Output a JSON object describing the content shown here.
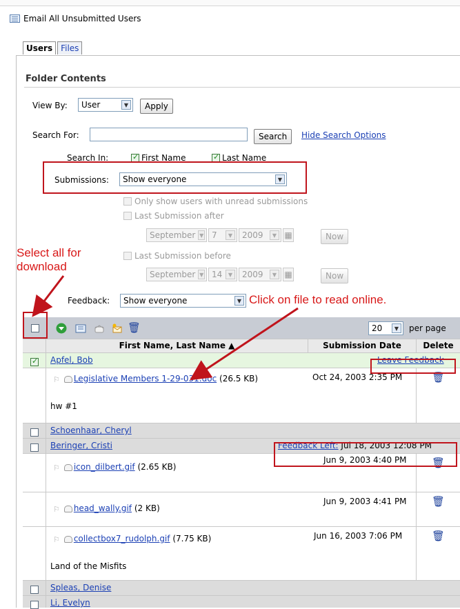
{
  "header": {
    "email_all": "Email All Unsubmitted Users"
  },
  "tabs": [
    {
      "label": "Users"
    },
    {
      "label": "Files"
    }
  ],
  "folder": {
    "title": "Folder Contents"
  },
  "view_by": {
    "label": "View By:",
    "value": "User",
    "apply": "Apply"
  },
  "search": {
    "label": "Search For:",
    "value": "",
    "button": "Search",
    "hide_options": "Hide Search Options"
  },
  "search_in": {
    "label": "Search In:",
    "first_name": "First Name",
    "last_name": "Last Name"
  },
  "submissions": {
    "label": "Submissions:",
    "value": "Show everyone"
  },
  "filters": {
    "unread": "Only show users with unread submissions",
    "after": "Last Submission after",
    "before": "Last Submission before",
    "after_date": {
      "month": "September",
      "day": "7",
      "year": "2009"
    },
    "before_date": {
      "month": "September",
      "day": "14",
      "year": "2009"
    },
    "now": "Now"
  },
  "feedback": {
    "label": "Feedback:",
    "value": "Show everyone"
  },
  "annotations": {
    "select_all": "Select all for\ndownload",
    "click_file": "Click on file to read online."
  },
  "toolbar": {
    "per_page_value": "20",
    "per_page_label": "per page"
  },
  "columns": {
    "name": "First Name, Last Name",
    "date": "Submission Date",
    "delete": "Delete"
  },
  "rows": {
    "apfel": {
      "name": "Apfel, Bob",
      "leave_feedback": "Leave Feedback"
    },
    "apfel_file": {
      "file": "Legislative Members 1-29-031.doc",
      "size": "(26.5 KB)",
      "date": "Oct 24, 2003 2:35 PM",
      "comment": "hw #1"
    },
    "schoenhaar": {
      "name": "Schoenhaar, Cheryl"
    },
    "beringer": {
      "name": "Beringer, Cristi",
      "feedback_left_label": "Feedback Left:",
      "feedback_left_date": "Jul 18, 2003 12:08 PM"
    },
    "file1": {
      "file": "icon_dilbert.gif",
      "size": "(2.65 KB)",
      "date": "Jun 9, 2003 4:40 PM"
    },
    "file2": {
      "file": "head_wally.gif",
      "size": "(2 KB)",
      "date": "Jun 9, 2003 4:41 PM"
    },
    "file3": {
      "file": "collectbox7_rudolph.gif",
      "size": "(7.75 KB)",
      "date": "Jun 16, 2003 7:06 PM",
      "comment": "Land of the Misfits"
    },
    "spleas": {
      "name": "Spleas, Denise"
    },
    "li": {
      "name": "Li, Evelyn"
    }
  }
}
